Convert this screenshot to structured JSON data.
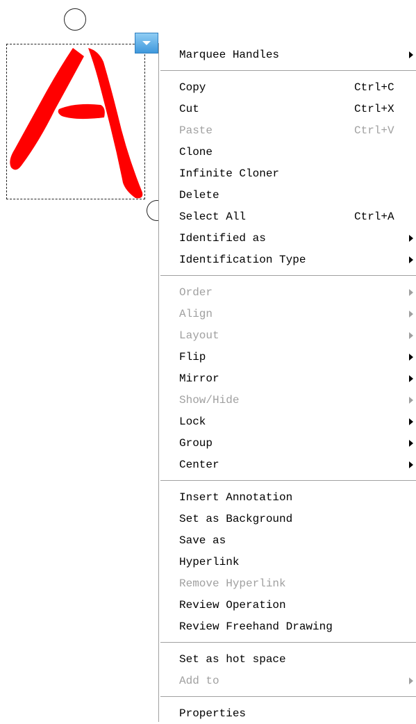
{
  "canvas": {
    "glyph_color": "#ff0000",
    "menu_button_color": "#3f98dc"
  },
  "menu": {
    "groups": [
      [
        {
          "label": "Marquee Handles",
          "submenu": true,
          "enabled": true
        }
      ],
      [
        {
          "label": "Copy",
          "shortcut": "Ctrl+C",
          "enabled": true
        },
        {
          "label": "Cut",
          "shortcut": "Ctrl+X",
          "enabled": true
        },
        {
          "label": "Paste",
          "shortcut": "Ctrl+V",
          "enabled": false
        },
        {
          "label": "Clone",
          "enabled": true
        },
        {
          "label": "Infinite Cloner",
          "enabled": true
        },
        {
          "label": "Delete",
          "enabled": true
        },
        {
          "label": "Select All",
          "shortcut": "Ctrl+A",
          "enabled": true
        },
        {
          "label": "Identified as",
          "submenu": true,
          "enabled": true
        },
        {
          "label": "Identification Type",
          "submenu": true,
          "enabled": true
        }
      ],
      [
        {
          "label": "Order",
          "submenu": true,
          "enabled": false
        },
        {
          "label": "Align",
          "submenu": true,
          "enabled": false
        },
        {
          "label": "Layout",
          "submenu": true,
          "enabled": false
        },
        {
          "label": "Flip",
          "submenu": true,
          "enabled": true
        },
        {
          "label": "Mirror",
          "submenu": true,
          "enabled": true
        },
        {
          "label": "Show/Hide",
          "submenu": true,
          "enabled": false
        },
        {
          "label": "Lock",
          "submenu": true,
          "enabled": true
        },
        {
          "label": "Group",
          "submenu": true,
          "enabled": true
        },
        {
          "label": "Center",
          "submenu": true,
          "enabled": true
        }
      ],
      [
        {
          "label": "Insert Annotation",
          "enabled": true
        },
        {
          "label": "Set as Background",
          "enabled": true
        },
        {
          "label": "Save as",
          "enabled": true
        },
        {
          "label": "Hyperlink",
          "enabled": true
        },
        {
          "label": "Remove Hyperlink",
          "enabled": false
        },
        {
          "label": "Review Operation",
          "enabled": true
        },
        {
          "label": "Review Freehand Drawing",
          "enabled": true
        }
      ],
      [
        {
          "label": "Set as hot space",
          "enabled": true
        },
        {
          "label": "Add to",
          "submenu": true,
          "enabled": false
        }
      ],
      [
        {
          "label": "Properties",
          "enabled": true
        }
      ]
    ]
  }
}
